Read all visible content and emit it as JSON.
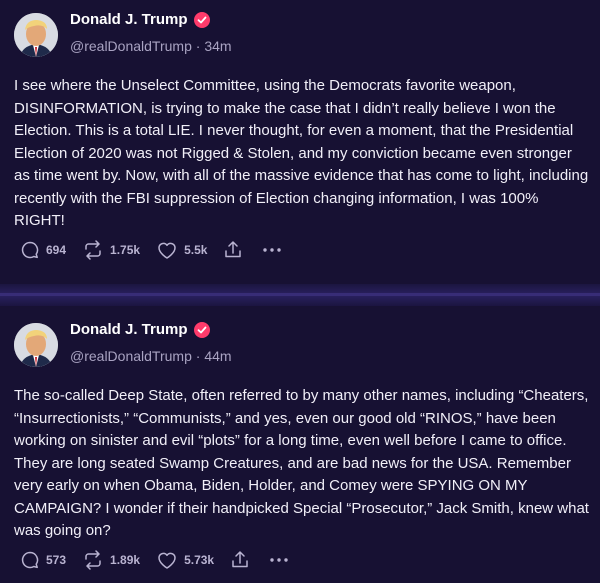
{
  "posts": [
    {
      "author": "Donald J. Trump",
      "handle": "@realDonaldTrump",
      "time": "34m",
      "body": "I see where the Unselect Committee, using the Democrats favorite weapon, DISINFORMATION, is trying to make the case that I didn’t really believe I won the Election. This is a total LIE. I never thought, for even a moment, that the Presidential Election of 2020 was not Rigged & Stolen, and my conviction became even stronger as time went by. Now, with all of the massive evidence that has come to light, including recently with the FBI suppression of Election changing information, I was 100% RIGHT!",
      "replies": "694",
      "retruths": "1.75k",
      "likes": "5.5k"
    },
    {
      "author": "Donald J. Trump",
      "handle": "@realDonaldTrump",
      "time": "44m",
      "body": "The so-called Deep State, often referred to by many other names, including “Cheaters, “Insurrectionists,” “Communists,” and yes, even our good old “RINOS,” have been working on sinister and evil “plots” for a long time, even well before I came to office. They are long seated Swamp Creatures, and are bad news for the USA. Remember very early on when Obama, Biden, Holder, and Comey were SPYING ON MY CAMPAIGN? I wonder if their handpicked Special “Prosecutor,” Jack Smith, knew what was going on?",
      "replies": "573",
      "retruths": "1.89k",
      "likes": "5.73k"
    }
  ],
  "separator": " · ",
  "icons": {
    "reply": "speech-bubble-icon",
    "retruth": "repost-arrows-icon",
    "like": "heart-icon",
    "share": "share-upload-icon",
    "more": "more-dots-icon",
    "verified": "verified-badge-icon"
  },
  "colors": {
    "background": "#171133",
    "verified": "#ff3b6b",
    "muted": "#a9a3c2"
  }
}
